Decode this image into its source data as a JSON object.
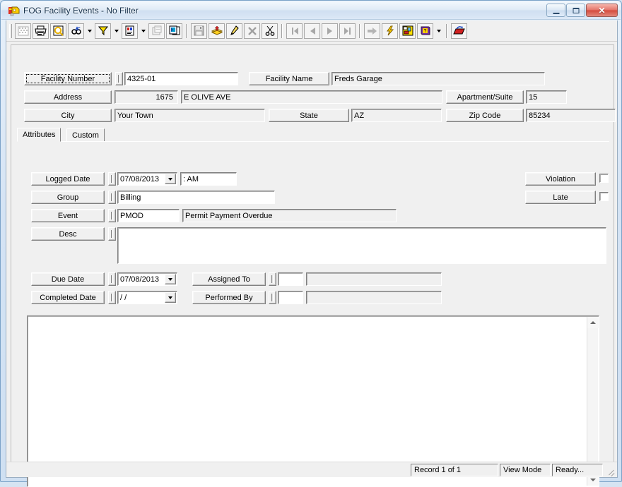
{
  "window": {
    "title": "FOG Facility Events - No Filter",
    "app_icon": "fog-app-icon",
    "controls": {
      "minimize": "Minimize",
      "maximize": "Maximize",
      "close": "Close"
    }
  },
  "toolbar": {
    "groups": [
      {
        "buttons": [
          {
            "name": "grid-view-icon",
            "glyph": "grid",
            "disabled": true,
            "dropdown": false
          },
          {
            "name": "print-icon",
            "glyph": "print",
            "disabled": false,
            "dropdown": false
          },
          {
            "name": "print-preview-icon",
            "glyph": "preview",
            "disabled": false,
            "dropdown": false
          },
          {
            "name": "find-icon",
            "glyph": "find",
            "disabled": false,
            "dropdown": true
          },
          {
            "name": "filter-icon",
            "glyph": "filter",
            "disabled": false,
            "dropdown": true
          },
          {
            "name": "report-icon",
            "glyph": "report",
            "disabled": false,
            "dropdown": true
          },
          {
            "name": "properties-icon",
            "glyph": "props",
            "disabled": true,
            "dropdown": false
          },
          {
            "name": "copy-record-icon",
            "glyph": "copyrec",
            "disabled": false,
            "dropdown": false
          }
        ]
      },
      {
        "buttons": [
          {
            "name": "save-icon",
            "glyph": "save",
            "disabled": true,
            "dropdown": false
          },
          {
            "name": "add-icon",
            "glyph": "add",
            "disabled": false,
            "dropdown": false
          },
          {
            "name": "edit-icon",
            "glyph": "edit",
            "disabled": false,
            "dropdown": false
          },
          {
            "name": "delete-icon",
            "glyph": "delete",
            "disabled": true,
            "dropdown": false
          },
          {
            "name": "cut-icon",
            "glyph": "cut",
            "disabled": false,
            "dropdown": false
          }
        ]
      },
      {
        "buttons": [
          {
            "name": "first-record-icon",
            "glyph": "first",
            "disabled": true,
            "dropdown": false
          },
          {
            "name": "previous-record-icon",
            "glyph": "prev",
            "disabled": true,
            "dropdown": false
          },
          {
            "name": "next-record-icon",
            "glyph": "next",
            "disabled": true,
            "dropdown": false
          },
          {
            "name": "last-record-icon",
            "glyph": "last",
            "disabled": true,
            "dropdown": false
          }
        ]
      },
      {
        "buttons": [
          {
            "name": "goto-icon",
            "glyph": "goto",
            "disabled": true,
            "dropdown": false
          },
          {
            "name": "action-icon",
            "glyph": "lightning",
            "disabled": false,
            "dropdown": false
          },
          {
            "name": "map-icon",
            "glyph": "map",
            "disabled": false,
            "dropdown": false
          },
          {
            "name": "help-icon",
            "glyph": "help",
            "disabled": false,
            "dropdown": true
          }
        ]
      },
      {
        "buttons": [
          {
            "name": "exit-icon",
            "glyph": "exit",
            "disabled": false,
            "dropdown": false
          }
        ]
      }
    ]
  },
  "header": {
    "facility_number": {
      "label": "Facility Number",
      "value": "4325-01",
      "focused": true
    },
    "facility_name": {
      "label": "Facility Name",
      "value": "Freds Garage"
    },
    "address": {
      "label": "Address",
      "number": "1675",
      "street": "E OLIVE AVE"
    },
    "apartment_suite": {
      "label": "Apartment/Suite",
      "value": "15"
    },
    "city": {
      "label": "City",
      "value": "Your Town"
    },
    "state": {
      "label": "State",
      "value": "AZ"
    },
    "zip_code": {
      "label": "Zip Code",
      "value": "85234"
    }
  },
  "tabs": [
    {
      "label": "Attributes",
      "active": true
    },
    {
      "label": "Custom",
      "active": false
    }
  ],
  "attributes": {
    "logged_date": {
      "label": "Logged Date",
      "value": "07/08/2013",
      "time": ":  AM"
    },
    "group": {
      "label": "Group",
      "value": "Billing"
    },
    "event": {
      "label": "Event",
      "code": "PMOD",
      "description": "Permit Payment Overdue"
    },
    "desc": {
      "label": "Desc",
      "value": ""
    },
    "violation": {
      "label": "Violation",
      "checked": false
    },
    "late": {
      "label": "Late",
      "checked": false
    },
    "due_date": {
      "label": "Due Date",
      "value": "07/08/2013"
    },
    "completed_date": {
      "label": "Completed Date",
      "value": "  /  /"
    },
    "assigned_to": {
      "label": "Assigned To",
      "code": "",
      "name": ""
    },
    "performed_by": {
      "label": "Performed By",
      "code": "",
      "name": ""
    }
  },
  "notes_area": {
    "value": ""
  },
  "statusbar": {
    "record": "Record 1 of 1",
    "mode": "View Mode",
    "state": "Ready..."
  }
}
